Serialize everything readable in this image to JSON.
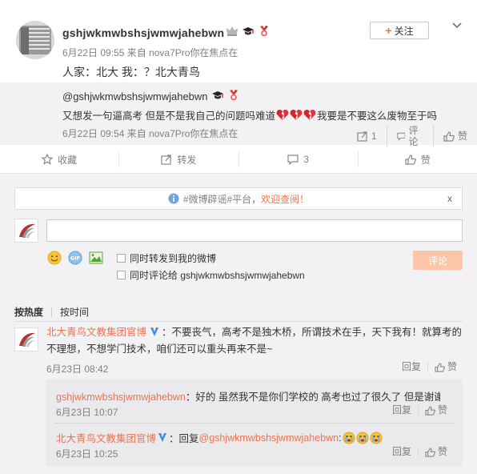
{
  "post": {
    "username": "gshjwkmwbshsjwmwjahebwn",
    "meta": "6月22日 09:55 来自 nova7Pro你在焦点在",
    "text": "人家：北大 我：？北大青鸟",
    "follow_label": "关注"
  },
  "quote": {
    "user": "@gshjwkmwbshsjwmwjahebwn",
    "text_a": "又想发一句逼高考 但是不是我自己的问题吗难道",
    "text_b": "我要是不要这么废物至于吗",
    "meta": "6月22日 09:54 来自 nova7Pro你在焦点在",
    "forward_count": "1",
    "comment_label": "评论",
    "like_label": "赞"
  },
  "action_bar": {
    "collect": "收藏",
    "forward": "转发",
    "comment_count": "3",
    "like": "赞"
  },
  "notice": {
    "prefix": "#微博辟谣#平台，",
    "link": "欢迎查阅！",
    "close": "x"
  },
  "composer": {
    "input_placeholder": "",
    "chk_forward": "同时转发到我的微博",
    "chk_comment": "同时评论给 gshjwkmwbshsjwmwjahebwn",
    "submit": "评论"
  },
  "sort": {
    "hot": "按热度",
    "time": "按时间"
  },
  "comment": {
    "author": "北大青鸟文教集团官博",
    "text": "：不要丧气，高考不是独木桥，所谓技术在手，天下我有！就算考的不理想，不想学门技术，咱们还可以重头再来不是~",
    "time": "6月23日 08:42",
    "reply_label": "回复",
    "like_label": "赞"
  },
  "replies": [
    {
      "author": "gshjwkmwbshsjwmwjahebwn",
      "text": "：好的 虽然我不是你们学校的 高考也过了很久了 但是谢谢",
      "time": "6月23日 10:07",
      "reply_label": "回复",
      "like_label": "赞"
    },
    {
      "author": "北大青鸟文教集团官博",
      "text_prefix": "：回复",
      "mention": "@gshjwkmwbshsjwmwjahebwn",
      "text_suffix": ":",
      "time": "6月23日 10:25",
      "reply_label": "回复",
      "like_label": "赞"
    }
  ],
  "colors": {
    "link": "#eb7350",
    "gray": "#808080",
    "comment_bg": "#f2f2f5",
    "submit_bg": "#fdc6a8",
    "verified_blue": "#3b8ce8"
  }
}
